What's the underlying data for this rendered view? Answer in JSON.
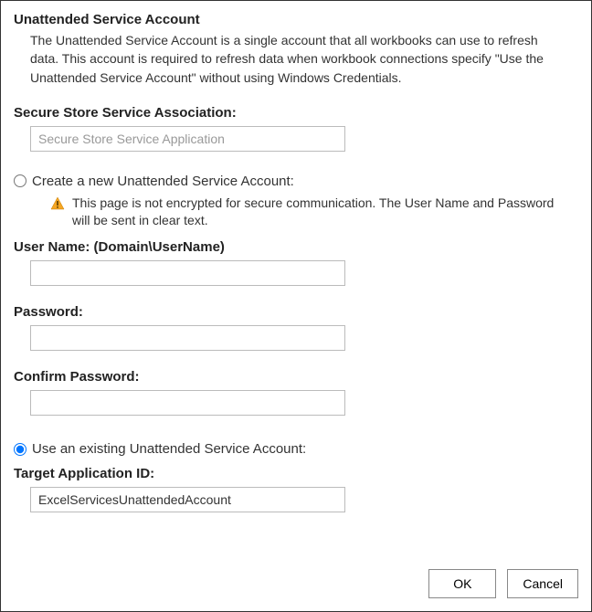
{
  "header": {
    "title": "Unattended Service Account",
    "description": "The Unattended Service Account is a single account that all workbooks can use to refresh data. This account is required to refresh data when workbook connections specify \"Use the Unattended Service Account\" without using Windows Credentials."
  },
  "secureStore": {
    "label": "Secure Store Service Association:",
    "value": "Secure Store Service Application"
  },
  "createOption": {
    "label": "Create a new Unattended Service Account:",
    "warning": "This page is not encrypted for secure communication. The User Name and Password will be sent in clear text.",
    "userNameLabel": "User Name: (Domain\\UserName)",
    "userNameValue": "",
    "passwordLabel": "Password:",
    "passwordValue": "",
    "confirmLabel": "Confirm Password:",
    "confirmValue": ""
  },
  "existingOption": {
    "label": "Use an existing Unattended Service Account:",
    "targetLabel": "Target Application ID:",
    "targetValue": "ExcelServicesUnattendedAccount"
  },
  "buttons": {
    "ok": "OK",
    "cancel": "Cancel"
  }
}
